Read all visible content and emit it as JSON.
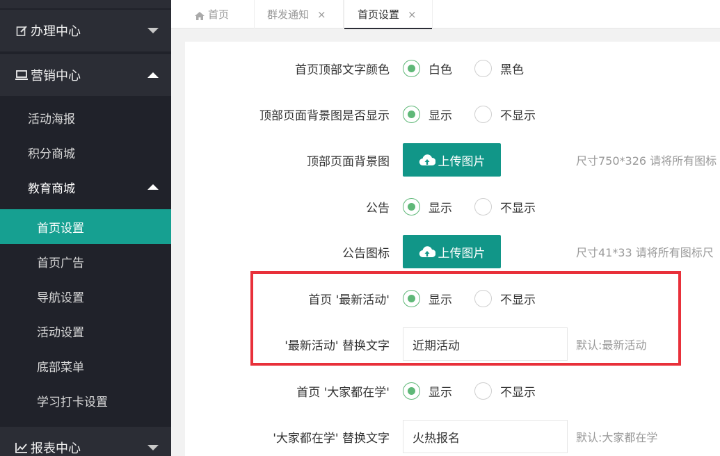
{
  "sidebar": {
    "groups": [
      {
        "label": "办理中心",
        "icon": "edit-icon",
        "expanded": false
      },
      {
        "label": "营销中心",
        "icon": "monitor-icon",
        "expanded": true
      },
      {
        "label": "报表中心",
        "icon": "chart-icon",
        "expanded": false
      }
    ],
    "marketing_items": [
      {
        "label": "活动海报"
      },
      {
        "label": "积分商城"
      },
      {
        "label": "教育商城",
        "expanded": true
      }
    ],
    "education_items": [
      {
        "label": "首页设置",
        "active": true
      },
      {
        "label": "首页广告"
      },
      {
        "label": "导航设置"
      },
      {
        "label": "活动设置"
      },
      {
        "label": "底部菜单"
      },
      {
        "label": "学习打卡设置"
      }
    ]
  },
  "tabs": [
    {
      "label": "首页",
      "icon": "home-icon",
      "closable": false
    },
    {
      "label": "群发通知",
      "closable": true,
      "close": "×"
    },
    {
      "label": "首页设置",
      "closable": true,
      "close": "×",
      "active": true
    }
  ],
  "form": {
    "rows": [
      {
        "label": "首页顶部文字颜色",
        "options": [
          "白色",
          "黑色"
        ],
        "selected": 0
      },
      {
        "label": "顶部页面背景图是否显示",
        "options": [
          "显示",
          "不显示"
        ],
        "selected": 0
      },
      {
        "label": "顶部页面背景图",
        "button": "上传图片",
        "hint": "尺寸750*326 请将所有图标"
      },
      {
        "label": "公告",
        "options": [
          "显示",
          "不显示"
        ],
        "selected": 0
      },
      {
        "label": "公告图标",
        "button": "上传图片",
        "hint": "尺寸41*33 请将所有图标尺"
      },
      {
        "label": "首页 '最新活动'",
        "options": [
          "显示",
          "不显示"
        ],
        "selected": 0
      },
      {
        "label": "'最新活动' 替换文字",
        "value": "近期活动",
        "hint": "默认:最新活动"
      },
      {
        "label": "首页 '大家都在学'",
        "options": [
          "显示",
          "不显示"
        ],
        "selected": 0
      },
      {
        "label": "'大家都在学' 替换文字",
        "value": "火热报名",
        "hint": "默认:大家都在学"
      }
    ]
  },
  "colors": {
    "sidebar_bg": "#20222a",
    "active_item": "#16a091",
    "upload_button": "#119688",
    "radio_checked": "#5fb878",
    "highlight_border": "#e8303a"
  }
}
